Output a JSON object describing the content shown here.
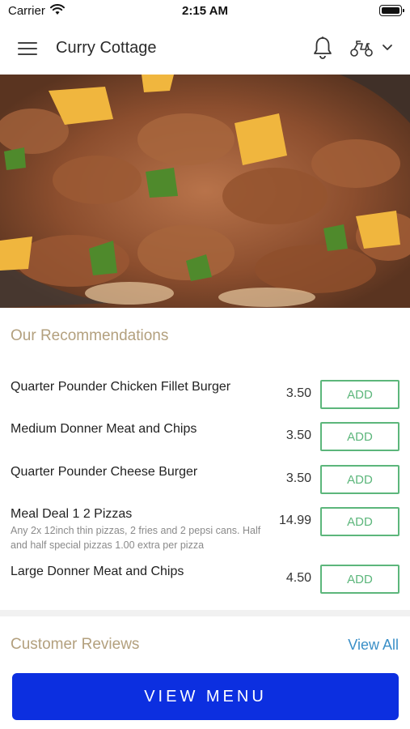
{
  "status_bar": {
    "carrier": "Carrier",
    "time": "2:15 AM"
  },
  "header": {
    "title": "Curry Cottage",
    "menu_icon": "hamburger-menu-icon",
    "notification_icon": "bell-icon",
    "delivery_icon": "scooter-icon",
    "dropdown_icon": "chevron-down-icon"
  },
  "recommendations": {
    "title": "Our Recommendations",
    "items": [
      {
        "name": "Quarter Pounder Chicken Fillet Burger",
        "description": "",
        "price": "3.50",
        "button": "ADD"
      },
      {
        "name": "Medium Donner Meat and Chips",
        "description": "",
        "price": "3.50",
        "button": "ADD"
      },
      {
        "name": "Quarter Pounder Cheese Burger",
        "description": "",
        "price": "3.50",
        "button": "ADD"
      },
      {
        "name": "Meal Deal 1 2 Pizzas",
        "description": "Any 2x 12inch thin pizzas, 2 fries and 2 pepsi cans. Half and half special pizzas 1.00 extra per pizza",
        "price": "14.99",
        "button": "ADD"
      },
      {
        "name": "Large Donner Meat and Chips",
        "description": "",
        "price": "4.50",
        "button": "ADD"
      }
    ]
  },
  "reviews": {
    "title": "Customer Reviews",
    "view_all": "View All"
  },
  "footer": {
    "view_menu": "VIEW MENU"
  },
  "colors": {
    "section_title": "#b3a07e",
    "add_button": "#5cb67b",
    "link": "#3a8fc7",
    "primary_button": "#0c2fe0"
  }
}
